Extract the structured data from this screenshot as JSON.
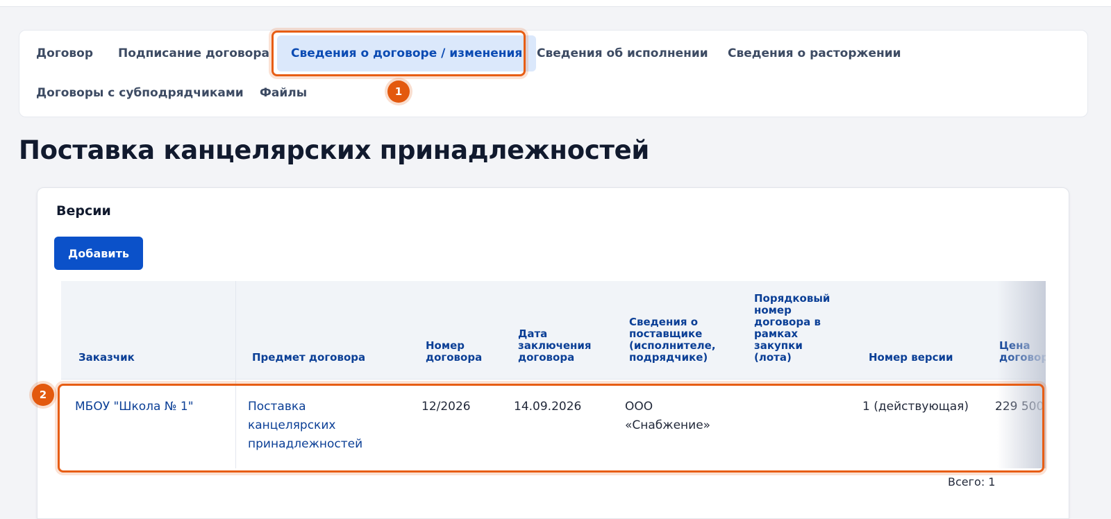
{
  "tabs": [
    {
      "label": "Договор"
    },
    {
      "label": "Подписание договора"
    },
    {
      "label": "Сведения о договоре / изменения",
      "active": true
    },
    {
      "label": "Сведения об исполнении"
    },
    {
      "label": "Сведения о расторжении"
    },
    {
      "label": "Договоры с субподрядчиками"
    },
    {
      "label": "Файлы"
    }
  ],
  "markers": [
    "1",
    "2"
  ],
  "page_title": "Поставка канцелярских принадлежностей",
  "versions": {
    "title": "Версии",
    "add_label": "Добавить",
    "columns": [
      "Заказчик",
      "Предмет договора",
      "Номер\nдоговора",
      "Дата\nзаключения\nдоговора",
      "Сведения о\nпоставщике\n(исполнителе,\nподрядчике)",
      "Порядковый\nномер\nдоговора в\nрамках\nзакупки\n(лота)",
      "Номер версии",
      "Цена\nдоговора"
    ],
    "rows": [
      {
        "customer": "МБОУ \"Школа № 1\"",
        "subject": "Поставка\nканцелярских\nпринадлежностей",
        "number": "12/2026",
        "date": "14.09.2026",
        "supplier": "ООО\n«Снабжение»",
        "lot_number": "",
        "version": "1 (действующая)",
        "price": "229 500"
      }
    ],
    "total": "Всего: 1"
  },
  "colors": {
    "accent": "#0b51c9",
    "highlight": "#e75d14",
    "active_tab_bg": "#dbe8fb",
    "header_text": "#0b3f96"
  }
}
